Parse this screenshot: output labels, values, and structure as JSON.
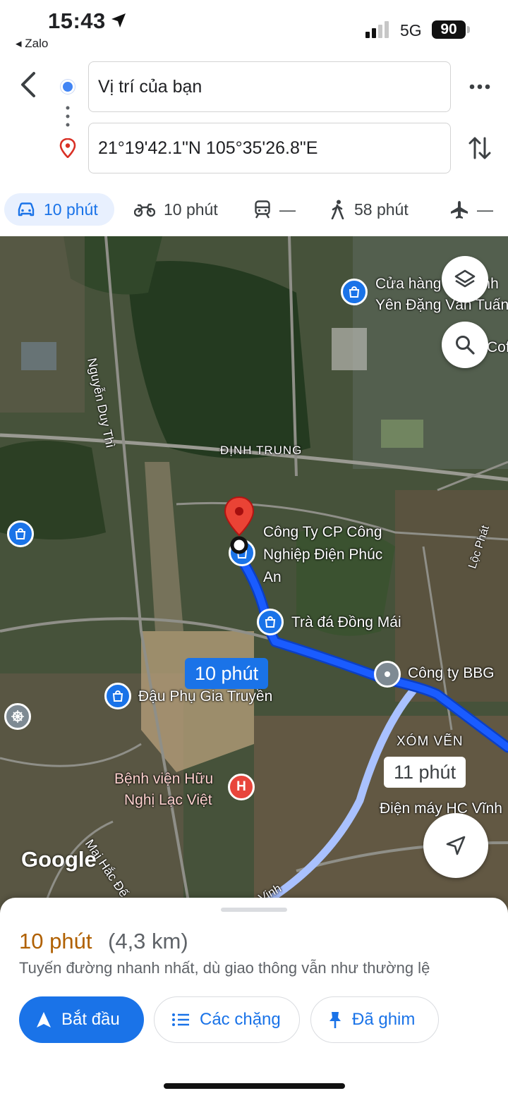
{
  "status_bar": {
    "time": "15:43",
    "back_app": "◂ Zalo",
    "network": "5G",
    "battery": "90"
  },
  "route": {
    "origin": "Vị trí của bạn",
    "destination": "21°19'42.1\"N 105°35'26.8\"E"
  },
  "modes": [
    {
      "name": "car",
      "label": "10 phút",
      "selected": true
    },
    {
      "name": "motorbike",
      "label": "10 phút"
    },
    {
      "name": "transit",
      "label": "—"
    },
    {
      "name": "walk",
      "label": "58 phút"
    },
    {
      "name": "flight",
      "label": "—"
    }
  ],
  "map": {
    "labels": {
      "dinh_trung": "ĐỊNH TRUNG",
      "nguyen_duy_thi": "Nguyễn Duy Thì",
      "loc_phat": "Lộc Phát",
      "xom_ven": "XÓM VẼN",
      "mai_hac_de": "Mai Hắc Đế",
      "dinh": "Vinh"
    },
    "places": {
      "shop_top_line1": "Cửa hàng VT Vĩnh",
      "shop_top_line2": "Yên Đặng Văn Tuấn",
      "cof": "Cof",
      "cong_ty_line1": "Công Ty CP Công",
      "cong_ty_line2": "Nghiệp Điện Phúc",
      "cong_ty_line3": "An",
      "tra_da": "Trà đá Đồng Mái",
      "cong_ty_bbg": "Công ty BBG",
      "dau_phu": "Đậu Phụ Gia Truyền",
      "benh_vien_line1": "Bệnh viện Hữu",
      "benh_vien_line2": "Nghị Lạc Việt",
      "dien_may": "Điện máy HC Vĩnh"
    },
    "eta_main": "10 phút",
    "eta_alt": "11 phút",
    "logo": "Google",
    "route_color": "#1a5cff",
    "alt_route_color": "#a9c1ff"
  },
  "sheet": {
    "time": "10 phút",
    "distance": "(4,3 km)",
    "note": "Tuyến đường nhanh nhất, dù giao thông vẫn như thường lệ",
    "start_label": "Bắt đầu",
    "steps_label": "Các chặng",
    "pinned_label": "Đã ghim"
  },
  "colors": {
    "accent": "#1a73e8",
    "eta_time": "#b06000",
    "pin": "#ea4335"
  }
}
